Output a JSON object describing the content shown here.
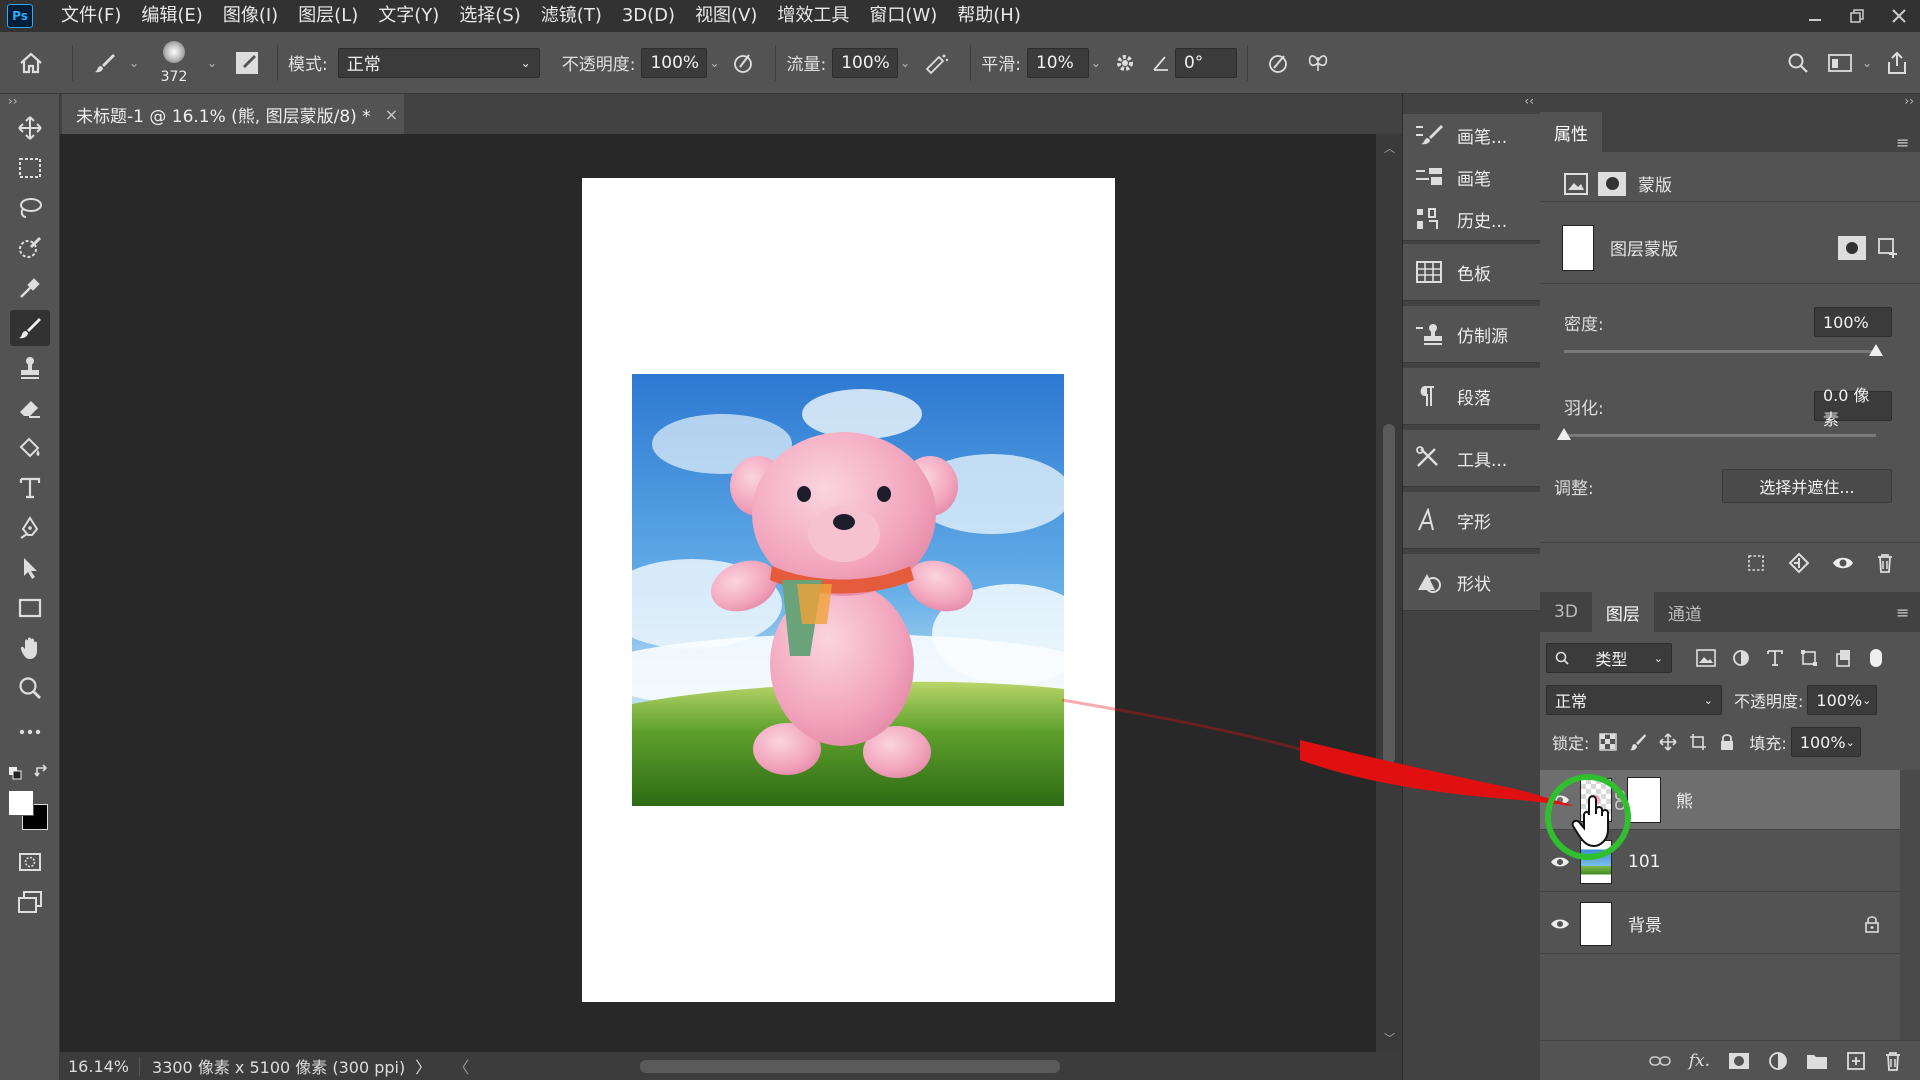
{
  "app": {
    "logo": "Ps"
  },
  "menu": [
    "文件(F)",
    "编辑(E)",
    "图像(I)",
    "图层(L)",
    "文字(Y)",
    "选择(S)",
    "滤镜(T)",
    "3D(D)",
    "视图(V)",
    "增效工具",
    "窗口(W)",
    "帮助(H)"
  ],
  "options": {
    "brush_size": "372",
    "mode_label": "模式:",
    "mode_value": "正常",
    "opacity_label": "不透明度:",
    "opacity_value": "100%",
    "flow_label": "流量:",
    "flow_value": "100%",
    "smooth_label": "平滑:",
    "smooth_value": "10%",
    "angle_value": "0°"
  },
  "document": {
    "tab_title": "未标题-1 @ 16.1% (熊, 图层蒙版/8) *",
    "close": "×",
    "zoom": "16.14%",
    "info": "3300 像素 x 5100 像素 (300 ppi)",
    "info_arrow": "〉",
    "scroll_left": "〈"
  },
  "dock": {
    "items": [
      "画笔...",
      "画笔",
      "历史...",
      "色板",
      "仿制源",
      "段落",
      "工具...",
      "字形",
      "形状"
    ]
  },
  "properties": {
    "tab": "属性",
    "section_mask": "蒙版",
    "mask_type": "图层蒙版",
    "density_label": "密度:",
    "density_value": "100%",
    "density_level": 100,
    "feather_label": "羽化:",
    "feather_value": "0.0 像素",
    "feather_level": 0,
    "adjust_label": "调整:",
    "select_mask_button": "选择并遮住..."
  },
  "layers_panel": {
    "tabs": [
      "3D",
      "图层",
      "通道"
    ],
    "active_tab": "图层",
    "filter_kind": "类型",
    "blend_mode": "正常",
    "opacity_label": "不透明度:",
    "opacity_value": "100%",
    "lock_label": "锁定:",
    "fill_label": "填充:",
    "fill_value": "100%",
    "layers": [
      {
        "name": "熊",
        "selected": true,
        "visible": true,
        "locked": false
      },
      {
        "name": "101",
        "selected": false,
        "visible": true,
        "locked": false
      },
      {
        "name": "背景",
        "selected": false,
        "visible": true,
        "locked": true
      }
    ]
  },
  "colors": {
    "accent_annotation_circle": "#2fbf2f",
    "accent_annotation_arrow": "#e01010"
  }
}
